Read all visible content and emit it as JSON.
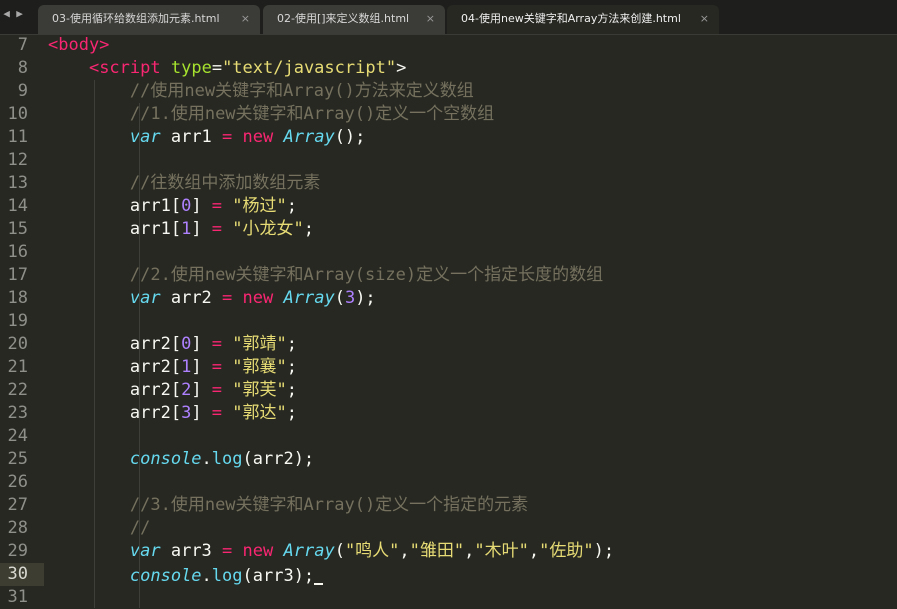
{
  "tabs": [
    {
      "label": "03-使用循环给数组添加元素.html",
      "close": "×"
    },
    {
      "label": "02-使用[]来定义数组.html",
      "close": "×"
    },
    {
      "label": "04-使用new关键字和Array方法来创建.html",
      "close": "×"
    }
  ],
  "nav": {
    "back": "◀",
    "forward": "▶"
  },
  "lines": [
    {
      "n": "7",
      "tokens": [
        [
          "tag",
          "<body>"
        ]
      ]
    },
    {
      "n": "8",
      "tokens": [
        [
          "plain",
          "    "
        ],
        [
          "tag",
          "<script"
        ],
        [
          "plain",
          " "
        ],
        [
          "attr",
          "type"
        ],
        [
          "plain",
          "="
        ],
        [
          "str",
          "\"text/javascript\""
        ],
        [
          "plain",
          ">"
        ]
      ]
    },
    {
      "n": "9",
      "tokens": [
        [
          "plain",
          "        "
        ],
        [
          "com",
          "//使用new关键字和Array()方法来定义数组"
        ]
      ]
    },
    {
      "n": "10",
      "tokens": [
        [
          "plain",
          "        "
        ],
        [
          "com",
          "//1.使用new关键字和Array()定义一个空数组"
        ]
      ]
    },
    {
      "n": "11",
      "tokens": [
        [
          "plain",
          "        "
        ],
        [
          "kw",
          "var"
        ],
        [
          "plain",
          " arr1 "
        ],
        [
          "op",
          "="
        ],
        [
          "plain",
          " "
        ],
        [
          "new",
          "new"
        ],
        [
          "plain",
          " "
        ],
        [
          "kw",
          "Array"
        ],
        [
          "plain",
          "();"
        ]
      ]
    },
    {
      "n": "12",
      "tokens": []
    },
    {
      "n": "13",
      "tokens": [
        [
          "plain",
          "        "
        ],
        [
          "com",
          "//往数组中添加数组元素"
        ]
      ]
    },
    {
      "n": "14",
      "tokens": [
        [
          "plain",
          "        arr1["
        ],
        [
          "num",
          "0"
        ],
        [
          "plain",
          "] "
        ],
        [
          "op",
          "="
        ],
        [
          "plain",
          " "
        ],
        [
          "str",
          "\"杨过\""
        ],
        [
          "plain",
          ";"
        ]
      ]
    },
    {
      "n": "15",
      "tokens": [
        [
          "plain",
          "        arr1["
        ],
        [
          "num",
          "1"
        ],
        [
          "plain",
          "] "
        ],
        [
          "op",
          "="
        ],
        [
          "plain",
          " "
        ],
        [
          "str",
          "\"小龙女\""
        ],
        [
          "plain",
          ";"
        ]
      ]
    },
    {
      "n": "16",
      "tokens": []
    },
    {
      "n": "17",
      "tokens": [
        [
          "plain",
          "        "
        ],
        [
          "com",
          "//2.使用new关键字和Array(size)定义一个指定长度的数组"
        ]
      ]
    },
    {
      "n": "18",
      "tokens": [
        [
          "plain",
          "        "
        ],
        [
          "kw",
          "var"
        ],
        [
          "plain",
          " arr2 "
        ],
        [
          "op",
          "="
        ],
        [
          "plain",
          " "
        ],
        [
          "new",
          "new"
        ],
        [
          "plain",
          " "
        ],
        [
          "kw",
          "Array"
        ],
        [
          "plain",
          "("
        ],
        [
          "num",
          "3"
        ],
        [
          "plain",
          ");"
        ]
      ]
    },
    {
      "n": "19",
      "tokens": []
    },
    {
      "n": "20",
      "tokens": [
        [
          "plain",
          "        arr2["
        ],
        [
          "num",
          "0"
        ],
        [
          "plain",
          "] "
        ],
        [
          "op",
          "="
        ],
        [
          "plain",
          " "
        ],
        [
          "str",
          "\"郭靖\""
        ],
        [
          "plain",
          ";"
        ]
      ]
    },
    {
      "n": "21",
      "tokens": [
        [
          "plain",
          "        arr2["
        ],
        [
          "num",
          "1"
        ],
        [
          "plain",
          "] "
        ],
        [
          "op",
          "="
        ],
        [
          "plain",
          " "
        ],
        [
          "str",
          "\"郭襄\""
        ],
        [
          "plain",
          ";"
        ]
      ]
    },
    {
      "n": "22",
      "tokens": [
        [
          "plain",
          "        arr2["
        ],
        [
          "num",
          "2"
        ],
        [
          "plain",
          "] "
        ],
        [
          "op",
          "="
        ],
        [
          "plain",
          " "
        ],
        [
          "str",
          "\"郭芙\""
        ],
        [
          "plain",
          ";"
        ]
      ]
    },
    {
      "n": "23",
      "tokens": [
        [
          "plain",
          "        arr2["
        ],
        [
          "num",
          "3"
        ],
        [
          "plain",
          "] "
        ],
        [
          "op",
          "="
        ],
        [
          "plain",
          " "
        ],
        [
          "str",
          "\"郭达\""
        ],
        [
          "plain",
          ";"
        ]
      ]
    },
    {
      "n": "24",
      "tokens": []
    },
    {
      "n": "25",
      "tokens": [
        [
          "plain",
          "        "
        ],
        [
          "kw",
          "console"
        ],
        [
          "plain",
          "."
        ],
        [
          "fn",
          "log"
        ],
        [
          "plain",
          "(arr2);"
        ]
      ]
    },
    {
      "n": "26",
      "tokens": []
    },
    {
      "n": "27",
      "tokens": [
        [
          "plain",
          "        "
        ],
        [
          "com",
          "//3.使用new关键字和Array()定义一个指定的元素"
        ]
      ]
    },
    {
      "n": "28",
      "tokens": [
        [
          "plain",
          "        "
        ],
        [
          "com",
          "//"
        ]
      ]
    },
    {
      "n": "29",
      "tokens": [
        [
          "plain",
          "        "
        ],
        [
          "kw",
          "var"
        ],
        [
          "plain",
          " arr3 "
        ],
        [
          "op",
          "="
        ],
        [
          "plain",
          " "
        ],
        [
          "new",
          "new"
        ],
        [
          "plain",
          " "
        ],
        [
          "kw",
          "Array"
        ],
        [
          "plain",
          "("
        ],
        [
          "str",
          "\"鸣人\""
        ],
        [
          "plain",
          ","
        ],
        [
          "str",
          "\"雏田\""
        ],
        [
          "plain",
          ","
        ],
        [
          "str",
          "\"木叶\""
        ],
        [
          "plain",
          ","
        ],
        [
          "str",
          "\"佐助\""
        ],
        [
          "plain",
          ");"
        ]
      ]
    },
    {
      "n": "30",
      "tokens": [
        [
          "plain",
          "        "
        ],
        [
          "kw",
          "console"
        ],
        [
          "plain",
          "."
        ],
        [
          "fn",
          "log"
        ],
        [
          "plain",
          "(arr3);"
        ]
      ],
      "current": true
    },
    {
      "n": "31",
      "tokens": []
    }
  ]
}
